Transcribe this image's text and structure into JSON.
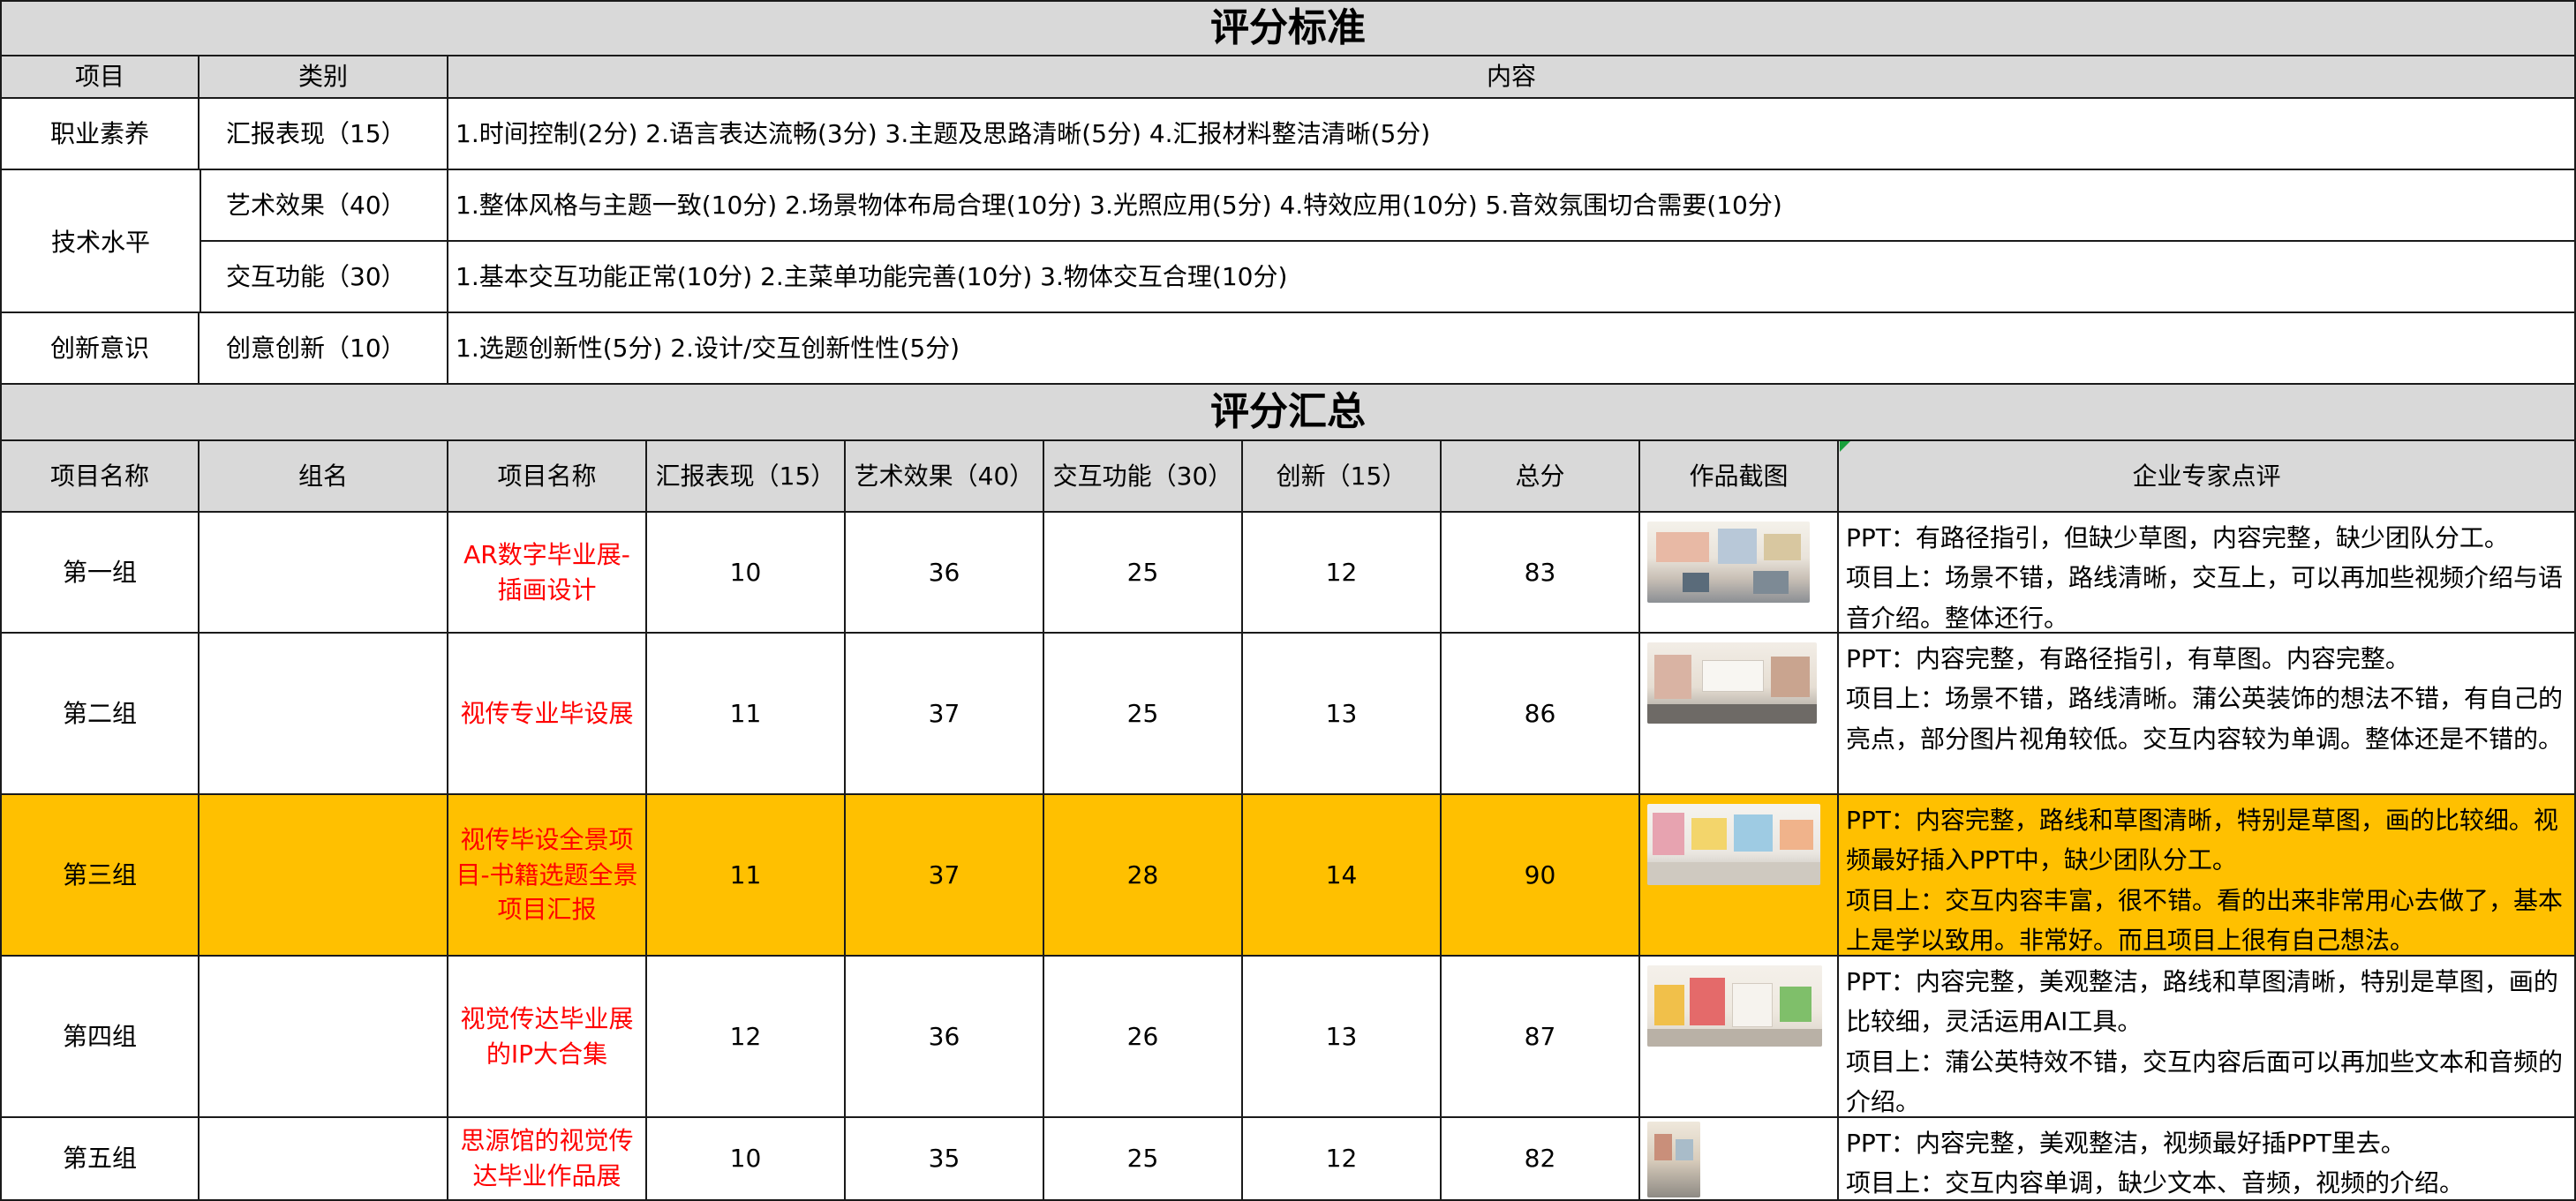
{
  "criteria": {
    "title": "评分标准",
    "headers": [
      "项目",
      "类别",
      "内容"
    ],
    "rows": [
      {
        "project": "职业素养",
        "category": "汇报表现（15）",
        "content": "1.时间控制(2分) 2.语言表达流畅(3分) 3.主题及思路清晰(5分) 4.汇报材料整洁清晰(5分)"
      },
      {
        "project": "技术水平",
        "category": "艺术效果（40）",
        "content": "1.整体风格与主题一致(10分) 2.场景物体布局合理(10分) 3.光照应用(5分) 4.特效应用(10分) 5.音效氛围切合需要(10分)"
      },
      {
        "project": "",
        "category": "交互功能（30）",
        "content": "1.基本交互功能正常(10分)  2.主菜单功能完善(10分)  3.物体交互合理(10分)"
      },
      {
        "project": "创新意识",
        "category": "创意创新（10）",
        "content": "1.选题创新性(5分)  2.设计/交互创新性性(5分)"
      }
    ]
  },
  "summary": {
    "title": "评分汇总",
    "headers": [
      "项目名称",
      "组名",
      "项目名称",
      "汇报表现（15）",
      "艺术效果（40）",
      "交互功能（30）",
      "创新（15）",
      "总分",
      "作品截图",
      "企业专家点评"
    ],
    "rows": [
      {
        "group": "第一组",
        "team": "",
        "name": "AR数字毕业展-插画设计",
        "report": "10",
        "art": "36",
        "interaction": "25",
        "innovation": "12",
        "total": "83",
        "thumb": "gallery-screenshot-1",
        "comment": [
          "PPT：有路径指引，但缺少草图，内容完整，缺少团队分工。",
          "项目上：场景不错，路线清晰，交互上，可以再加些视频介绍与语音介绍。整体还行。"
        ]
      },
      {
        "group": "第二组",
        "team": "",
        "name": "视传专业毕设展",
        "report": "11",
        "art": "37",
        "interaction": "25",
        "innovation": "13",
        "total": "86",
        "thumb": "gallery-screenshot-2",
        "comment": [
          "PPT：内容完整，有路径指引，有草图。内容完整。",
          "项目上：场景不错，路线清晰。蒲公英装饰的想法不错，有自己的亮点，部分图片视角较低。交互内容较为单调。整体还是不错的。"
        ]
      },
      {
        "group": "第三组",
        "team": "",
        "name": "视传毕设全景项目-书籍选题全景项目汇报",
        "report": "11",
        "art": "37",
        "interaction": "28",
        "innovation": "14",
        "total": "90",
        "thumb": "gallery-screenshot-3",
        "highlight": true,
        "comment": [
          "PPT：内容完整，路线和草图清晰，特别是草图，画的比较细。视频最好插入PPT中，缺少团队分工。",
          "项目上：交互内容丰富，很不错。看的出来非常用心去做了，基本上是学以致用。非常好。而且项目上很有自己想法。"
        ]
      },
      {
        "group": "第四组",
        "team": "",
        "name": "视觉传达毕业展的IP大合集",
        "report": "12",
        "art": "36",
        "interaction": "26",
        "innovation": "13",
        "total": "87",
        "thumb": "gallery-screenshot-4",
        "comment": [
          "PPT：内容完整，美观整洁，路线和草图清晰，特别是草图，画的比较细，灵活运用AI工具。",
          "项目上：蒲公英特效不错，交互内容后面可以再加些文本和音频的介绍。"
        ]
      },
      {
        "group": "第五组",
        "team": "",
        "name": "思源馆的视觉传达毕业作品展",
        "report": "10",
        "art": "35",
        "interaction": "25",
        "innovation": "12",
        "total": "82",
        "thumb": "gallery-screenshot-5",
        "comment": [
          "PPT：内容完整，美观整洁，视频最好插PPT里去。",
          "项目上：交互内容单调，缺少文本、音频，视频的介绍。"
        ]
      }
    ]
  },
  "colors": {
    "header_gray": "#d9d9d9",
    "highlight": "#ffc000",
    "project_name": "#ff0000",
    "comment_flag": "#1aa03c"
  }
}
